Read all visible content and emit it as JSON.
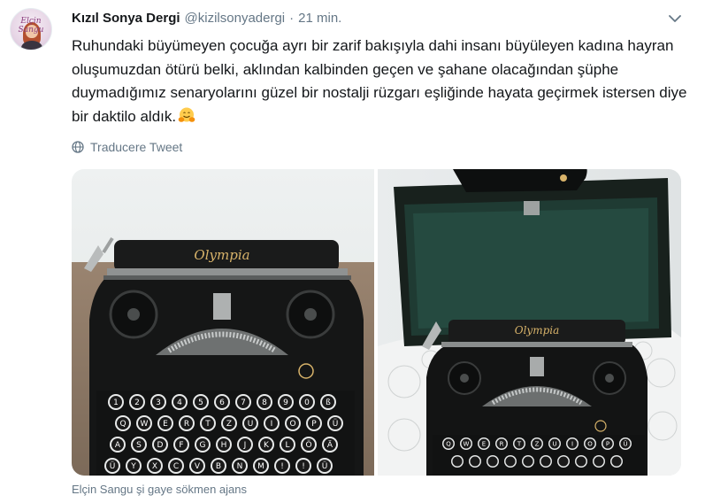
{
  "tweet": {
    "author_name": "Kızıl Sonya Dergi",
    "author_handle": "@kizilsonyadergi",
    "separator": "·",
    "timestamp": "21 min.",
    "text": "Ruhundaki büyümeyen çocuğa ayrı bir zarif bakışıyla dahi insanı büyüleyen kadına hayran oluşumuzdan ötürü belki, aklından kalbinden geçen ve şahane olacağından şüphe duymadığımız senaryolarını güzel bir nostalji rüzgarı eşliğinde hayata geçirmek istersen diye bir daktilo aldık.",
    "emoji_icon": "hugging-face-emoji",
    "translate_label": "Traducere Tweet",
    "translate_icon": "globe-icon",
    "menu_icon": "chevron-down-icon",
    "photo_caption": "Elçin Sangu şi gaye sökmen ajans"
  },
  "avatar": {
    "title": "Elçin Sangu"
  },
  "photos": {
    "left_brand": "Olympia",
    "right_brand": "Olympia",
    "left_keys": [
      [
        "1",
        "2",
        "3",
        "4",
        "5",
        "6",
        "7",
        "8",
        "9",
        "0",
        "ß"
      ],
      [
        "Q",
        "W",
        "E",
        "R",
        "T",
        "Z",
        "U",
        "I",
        "O",
        "P",
        "Ü"
      ],
      [
        "A",
        "S",
        "D",
        "F",
        "G",
        "H",
        "J",
        "K",
        "L",
        "Ö",
        "Ä"
      ],
      [
        "Ü",
        "Y",
        "X",
        "C",
        "V",
        "B",
        "N",
        "M",
        "!",
        "!",
        "Ü"
      ]
    ],
    "right_keys": [
      [
        "Q",
        "W",
        "E",
        "R",
        "T",
        "Z",
        "U",
        "I",
        "O",
        "P",
        "Ü"
      ]
    ]
  },
  "colors": {
    "name": "#14171a",
    "secondary": "#657786",
    "link": "#1da1f2"
  }
}
